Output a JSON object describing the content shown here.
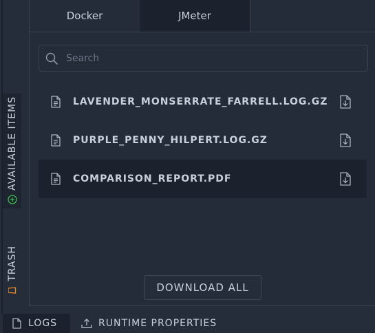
{
  "sidebar": {
    "available_label": "AVAILABLE ITEMS",
    "trash_label": "TRASH"
  },
  "tabs": [
    {
      "label": "Docker",
      "active": false
    },
    {
      "label": "JMeter",
      "active": true
    }
  ],
  "search": {
    "placeholder": "Search",
    "value": ""
  },
  "files": [
    {
      "name": "LAVENDER_MONSERRATE_FARRELL.LOG.GZ",
      "selected": false
    },
    {
      "name": "PURPLE_PENNY_HILPERT.LOG.GZ",
      "selected": false
    },
    {
      "name": "COMPARISON_REPORT.PDF",
      "selected": true
    }
  ],
  "actions": {
    "download_all_label": "DOWNLOAD ALL"
  },
  "bottom_tabs": {
    "logs_label": "LOGS",
    "runtime_label": "RUNTIME PROPERTIES"
  },
  "colors": {
    "background": "#252d3a",
    "panel": "#242c39",
    "selected": "#1c222d",
    "text": "#c8d0dc",
    "accent_green": "#3fb950",
    "accent_orange": "#e8891a"
  },
  "icons": {
    "available": "plus-circle-icon",
    "trash": "trash-icon",
    "search": "search-icon",
    "file": "file-text-icon",
    "download": "file-download-icon",
    "logs": "document-icon",
    "runtime": "upload-icon"
  }
}
